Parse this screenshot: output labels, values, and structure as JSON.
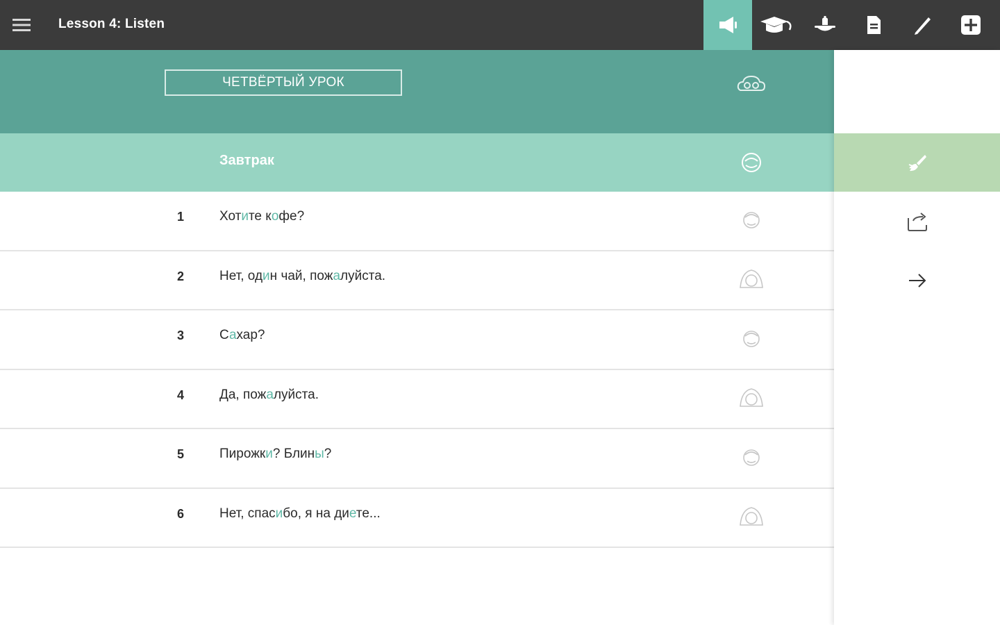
{
  "app": {
    "lesson_title": "Lesson 4: Listen"
  },
  "toolbar": {
    "icons": [
      "megaphone-icon",
      "graduation-cap-icon",
      "food-dish-icon",
      "document-icon",
      "pen-icon",
      "plus-square-icon"
    ],
    "active": "megaphone-icon"
  },
  "lesson": {
    "title": "ЧЕТВЁРТЫЙ УРОК"
  },
  "dialog": {
    "title": "Завтрак"
  },
  "lines": [
    {
      "num": "1",
      "parts": [
        "Хот",
        "и",
        "те к",
        "о",
        "фе?"
      ]
    },
    {
      "num": "2",
      "parts": [
        "Нет, од",
        "и",
        "н чай, пож",
        "а",
        "луйста."
      ]
    },
    {
      "num": "3",
      "parts": [
        "С",
        "а",
        "хар?"
      ]
    },
    {
      "num": "4",
      "parts": [
        "Да, пож",
        "а",
        "луйста."
      ]
    },
    {
      "num": "5",
      "parts": [
        "Пирожк",
        "и",
        "? Блин",
        "ы",
        "?"
      ]
    },
    {
      "num": "6",
      "parts": [
        "Нет, спас",
        "и",
        "бо, я на ди",
        "е",
        "те..."
      ]
    }
  ],
  "colors": {
    "topbar": "#3b3b3b",
    "accent": "#72c2b2",
    "lesson_header": "#5ba396",
    "dialog_header": "#97d4c2",
    "side_active": "#b8d9b2",
    "stress": "#5fb8a6"
  }
}
